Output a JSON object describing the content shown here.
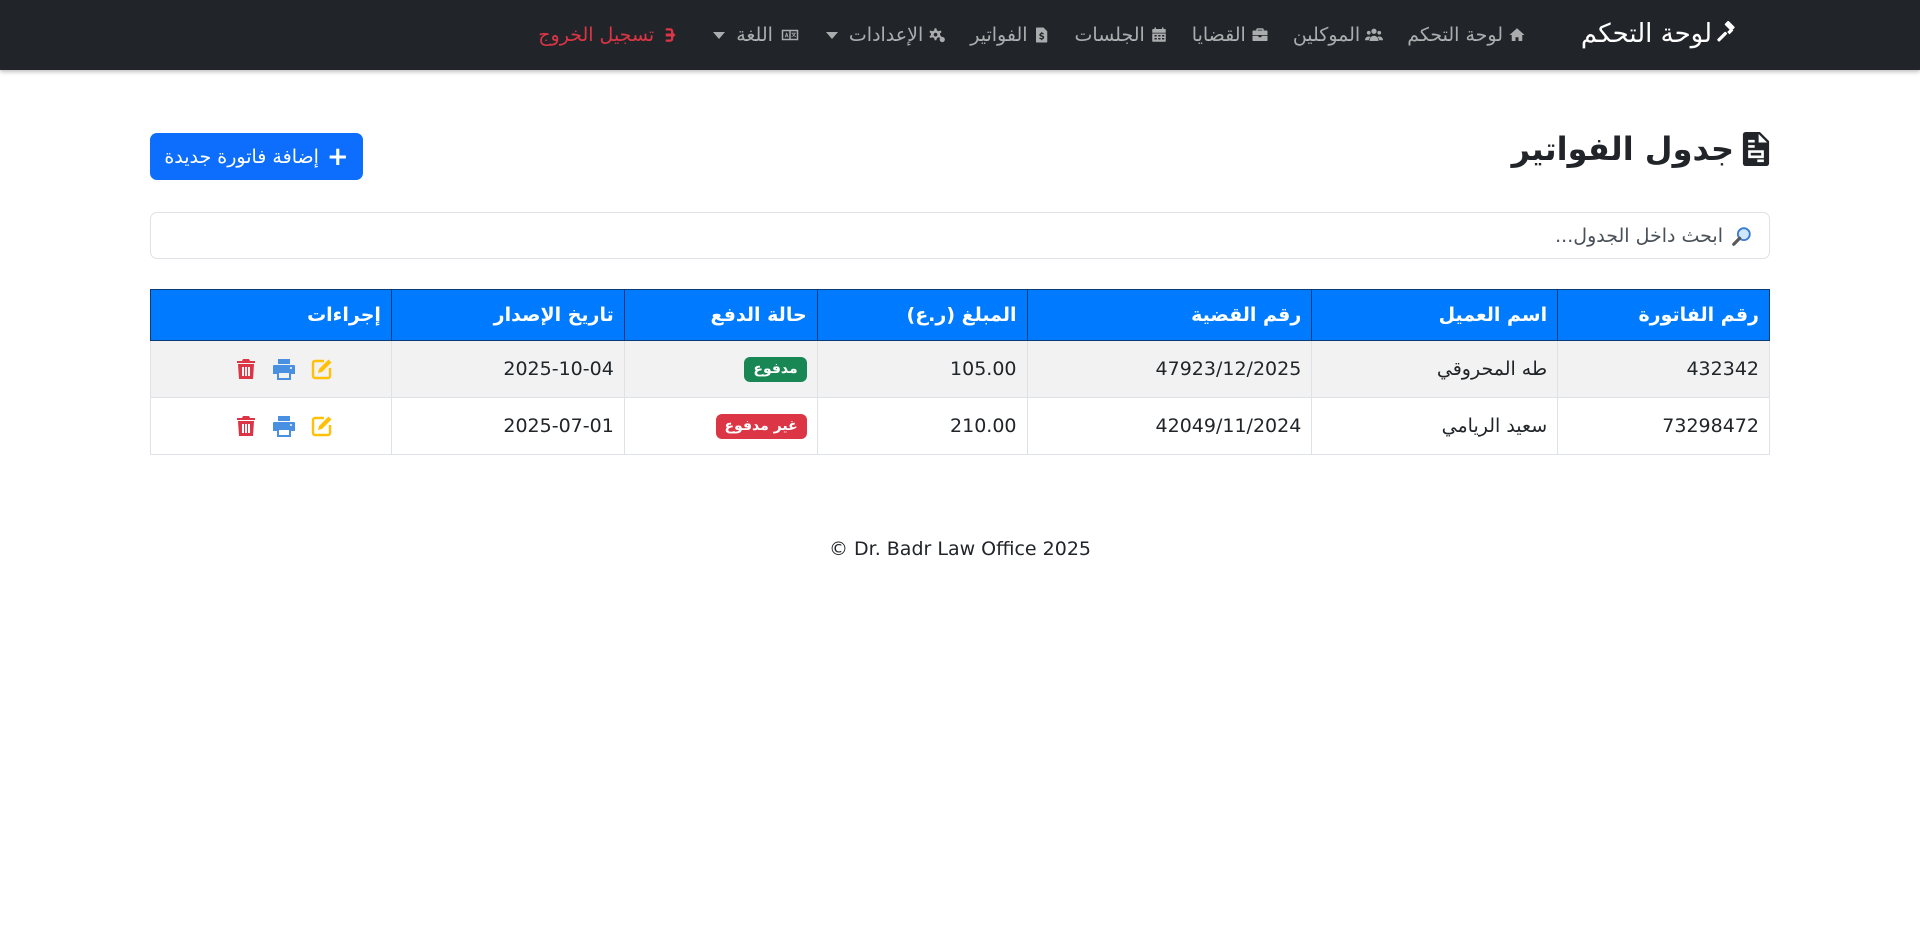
{
  "navbar": {
    "brand": "لوحة التحكم",
    "links": {
      "dashboard": "لوحة التحكم",
      "clients": "الموكلين",
      "cases": "القضايا",
      "sessions": "الجلسات",
      "invoices": "الفواتير",
      "settings": "الإعدادات",
      "language": "اللغة",
      "logout": "تسجيل الخروج"
    }
  },
  "page": {
    "title": "جدول الفواتير",
    "add_button": "إضافة فاتورة جديدة",
    "search_placeholder": "ابحث داخل الجدول..."
  },
  "table": {
    "headers": [
      "رقم الفاتورة",
      "اسم العميل",
      "رقم القضية",
      "المبلغ (ر.ع)",
      "حالة الدفع",
      "تاريخ الإصدار",
      "إجراءات"
    ],
    "rows": [
      {
        "invoice_no": "432342",
        "client": "طه المحروقي",
        "case_no": "47923/12/2025",
        "amount": "105.00",
        "status": "مدفوع",
        "status_color": "#198754",
        "date": "2025-10-04"
      },
      {
        "invoice_no": "73298472",
        "client": "سعيد الريامي",
        "case_no": "42049/11/2024",
        "amount": "210.00",
        "status": "غير مدفوع",
        "status_color": "#dc3545",
        "date": "2025-07-01"
      }
    ]
  },
  "footer": "© Dr. Badr Law Office 2025",
  "colors": {
    "navbar": "#212529",
    "primary": "#0d6efd",
    "table_header": "#007bff",
    "paid": "#198754",
    "unpaid": "#dc3545",
    "edit": "#ffc107",
    "print": "#4a90e2",
    "delete": "#dc3545"
  },
  "icons": [
    "gavel-icon",
    "home-icon",
    "users-icon",
    "briefcase-icon",
    "calendar-icon",
    "invoice-icon",
    "gears-icon",
    "language-icon",
    "logout-icon",
    "file-invoice-icon",
    "plus-icon",
    "search-icon",
    "edit-icon",
    "print-icon",
    "trash-icon"
  ]
}
